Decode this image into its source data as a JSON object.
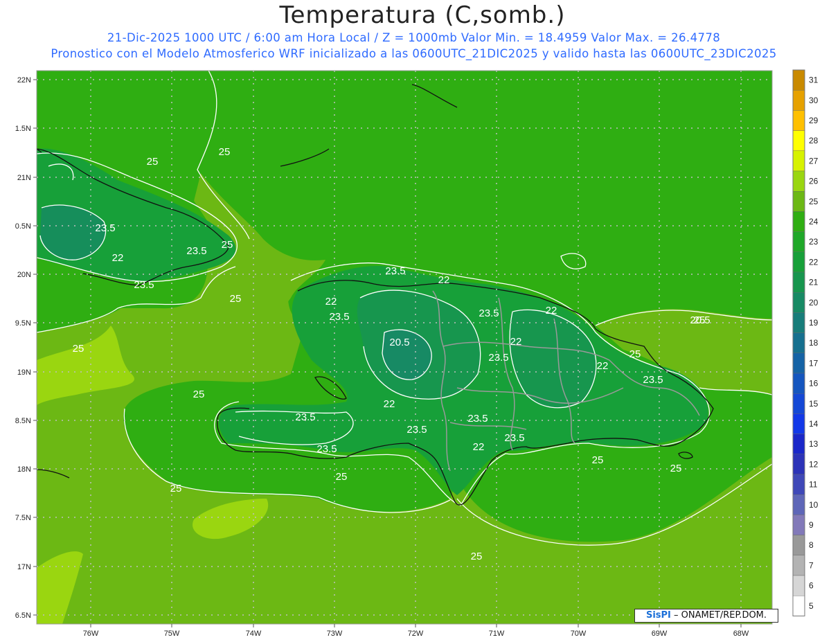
{
  "header": {
    "title": "Temperatura (C,somb.)",
    "subtitle_1": "21-Dic-2025  1000 UTC / 6:00 am Hora Local / Z = 1000mb   Valor Min. = 18.4959  Valor Max. = 26.4778",
    "subtitle_2": "Pronostico con el Modelo Atmosferico WRF inicializado a las 0600UTC_21DIC2025 y valido hasta las  0600UTC_23DIC2025"
  },
  "map": {
    "lon_range": [
      -76.65,
      -67.6
    ],
    "lat_range": [
      16.45,
      22.1
    ],
    "lon_ticks": [
      "76W",
      "75W",
      "74W",
      "73W",
      "72W",
      "71W",
      "70W",
      "69W",
      "68W"
    ],
    "lat_ticks": [
      "22N",
      "1.5N",
      "21N",
      "0.5N",
      "20N",
      "9.5N",
      "19N",
      "8.5N",
      "18N",
      "7.5N",
      "17N",
      "6.5N"
    ],
    "grid": "dotted",
    "contour_labels": [
      "25",
      "25",
      "23.5",
      "22",
      "23.5",
      "25",
      "23.5",
      "25",
      "25",
      "23.5",
      "25",
      "23.5",
      "22",
      "22",
      "23.5",
      "22",
      "20.5",
      "23.5",
      "25",
      "20.5",
      "23.5",
      "22",
      "22",
      "25",
      "23.5",
      "25",
      "22",
      "23.5",
      "23.5",
      "23.5",
      "22",
      "23.5",
      "25",
      "25",
      "25",
      "25",
      "23.5",
      "25",
      "25"
    ]
  },
  "colorbar": {
    "levels": [
      "31",
      "30",
      "29",
      "28",
      "27",
      "26",
      "25",
      "24",
      "23",
      "22",
      "21",
      "20",
      "19",
      "18",
      "17",
      "16",
      "15",
      "14",
      "13",
      "12",
      "11",
      "10",
      "9",
      "8",
      "7",
      "6",
      "5"
    ],
    "colors": [
      "#c98a00",
      "#e6a100",
      "#ffc000",
      "#ffff00",
      "#d7f200",
      "#9ad610",
      "#6cb814",
      "#2fae12",
      "#1fa828",
      "#17a039",
      "#17964e",
      "#178a64",
      "#177d7a",
      "#16708f",
      "#1563a6",
      "#1556bf",
      "#1448d6",
      "#1238e8",
      "#1a27c9",
      "#2c33b8",
      "#3f48b8",
      "#5e66b8",
      "#8279b9",
      "#999999",
      "#b3b3b3",
      "#d6d6d6",
      "#ffffff"
    ]
  },
  "footer": {
    "logo_text": "SisPI",
    "credit_text": "– ONAMET/REP.DOM."
  }
}
